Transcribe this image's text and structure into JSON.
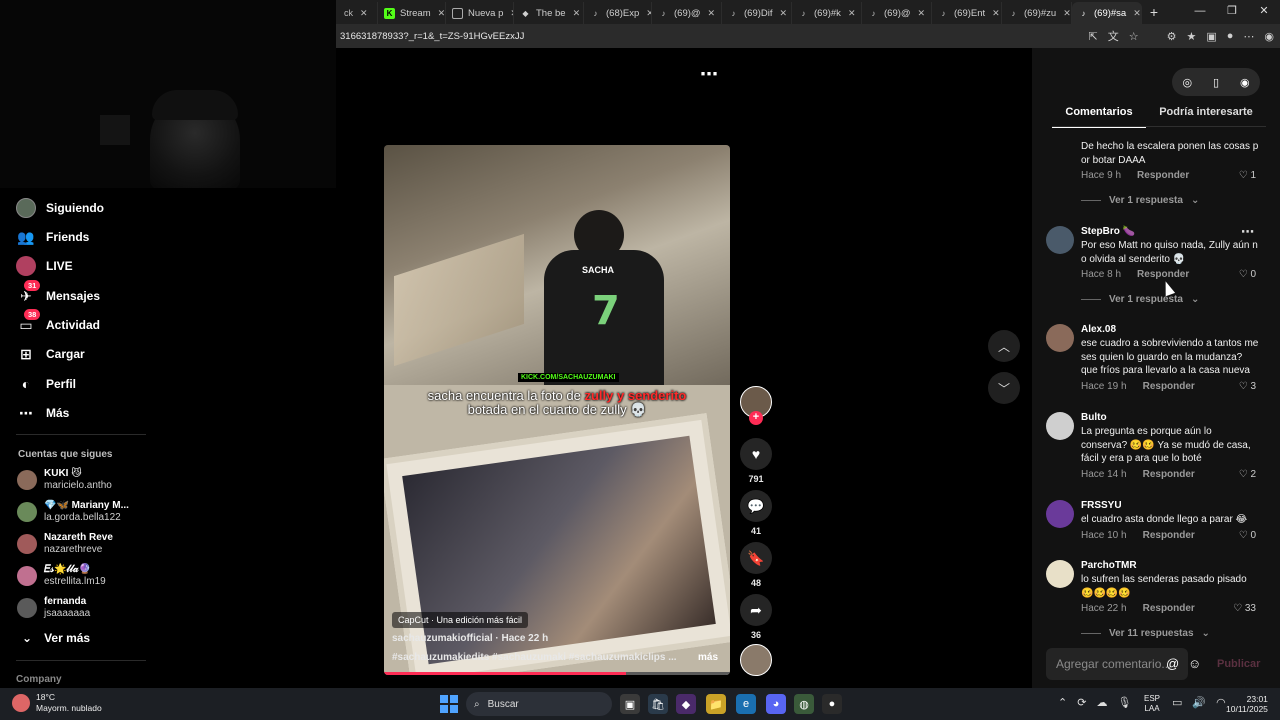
{
  "browser": {
    "tabs": [
      {
        "label": "ck",
        "icon": "tab-icon",
        "color": "#444"
      },
      {
        "label": "Stream",
        "icon": "kick-icon",
        "color": "#53fc18"
      },
      {
        "label": "Nueva p",
        "icon": "newtab-icon",
        "color": "#888"
      },
      {
        "label": "The be",
        "icon": "shield-icon",
        "color": "#ddd"
      },
      {
        "label": "(68)Exp",
        "icon": "tiktok-icon",
        "color": "#fff"
      },
      {
        "label": "(69)@",
        "icon": "tiktok-icon",
        "color": "#fff"
      },
      {
        "label": "(69)Dif",
        "icon": "tiktok-icon",
        "color": "#fff"
      },
      {
        "label": "(69)#k",
        "icon": "tiktok-icon",
        "color": "#fff"
      },
      {
        "label": "(69)@",
        "icon": "tiktok-icon",
        "color": "#fff"
      },
      {
        "label": "(69)Ent",
        "icon": "tiktok-icon",
        "color": "#fff"
      },
      {
        "label": "(69)#zu",
        "icon": "tiktok-icon",
        "color": "#fff"
      },
      {
        "label": "(69)#sa",
        "icon": "tiktok-icon",
        "color": "#fff"
      }
    ],
    "url": "316631878933?_r=1&_t=ZS-91HGvEEzxJJ"
  },
  "nav": {
    "items": [
      {
        "label": "Siguiendo",
        "icon": "following-avatar-icon"
      },
      {
        "label": "Friends",
        "icon": "friends-icon"
      },
      {
        "label": "LIVE",
        "icon": "live-icon"
      },
      {
        "label": "Mensajes",
        "icon": "messages-icon",
        "badge": "31"
      },
      {
        "label": "Actividad",
        "icon": "activity-icon",
        "badge": "38"
      },
      {
        "label": "Cargar",
        "icon": "upload-icon"
      },
      {
        "label": "Perfil",
        "icon": "profile-icon"
      },
      {
        "label": "Más",
        "icon": "more-icon"
      }
    ],
    "following_header": "Cuentas que sigues",
    "following": [
      {
        "name": "KUKI 😼",
        "user": "maricielo.antho",
        "color": "#8a6a5a"
      },
      {
        "name": "💎🦋 Mariany M...",
        "user": "la.gorda.bella122",
        "color": "#6a8a5a"
      },
      {
        "name": "Nazareth Reve",
        "user": "nazarethreve",
        "color": "#a05a5a"
      },
      {
        "name": "𝐸𝓈🌟𝓁𝓁𝒶🔮",
        "user": "estrellita.lm19",
        "color": "#c07090"
      },
      {
        "name": "fernanda",
        "user": "jsaaaaaaa",
        "color": "#5a5a5a"
      }
    ],
    "see_more": "Ver más",
    "company": "Company"
  },
  "video": {
    "caption_pre": "sacha encuentra la foto de ",
    "caption_red": "zully y senderito",
    "caption_post": "botada en el cuarto de zully 💀",
    "jersey_name": "SACHA",
    "jersey_number": "7",
    "kick_tag": "KICK.COM/SACHAUZUMAKI",
    "capcut": "CapCut · Una edición más fácil",
    "author_time": "sachauzumakiofficial · Hace 22 h",
    "tags": "#sachauzumakiedits #sachauzumaki #sachauzumakiclips ...",
    "more": "más",
    "progress": 0.7
  },
  "actions": {
    "likes": "791",
    "comments": "41",
    "saves": "48",
    "shares": "36"
  },
  "panel": {
    "tab_comments": "Comentarios",
    "tab_interest": "Podría interesarte",
    "reply_label": "Responder",
    "comments": [
      {
        "user": "",
        "text": "De hecho la escalera ponen las cosas p or botar DAAA",
        "time": "Hace 9 h",
        "likes": "1",
        "replies": "Ver 1 respuesta",
        "color": "#121212"
      },
      {
        "user": "StepBro 🍆",
        "text": "Por eso Matt no quiso nada, Zully aún n o olvida al senderito 💀",
        "time": "Hace 8 h",
        "likes": "0",
        "replies": "Ver 1 respuesta",
        "color": "#4a5a6a"
      },
      {
        "user": "Alex.08",
        "text": "ese cuadro a sobreviviendo a tantos me ses quien lo guardo en la mudanza? que fríos para llevarlo a la casa nueva",
        "time": "Hace 19 h",
        "likes": "3",
        "replies": "",
        "color": "#8a6a5a"
      },
      {
        "user": "Bulto",
        "text": "La pregunta es porque aún lo conserva? 🥴🥴 Ya se mudó de casa, fácil y era p ara que lo boté",
        "time": "Hace 14 h",
        "likes": "2",
        "replies": "",
        "color": "#cfcfcf"
      },
      {
        "user": "FRSSYU",
        "text": "el cuadro asta donde llego a parar 😂",
        "time": "Hace 10 h",
        "likes": "0",
        "replies": "",
        "color": "#6a3a9a"
      },
      {
        "user": "ParchoTMR",
        "text": "lo sufren las senderas pasado pisado 🥴🥴🥴🥴",
        "time": "Hace 22 h",
        "likes": "33",
        "replies": "Ver 11 respuestas",
        "color": "#e8e0c8"
      }
    ],
    "input_placeholder": "Agregar comentario...",
    "publish": "Publicar"
  },
  "taskbar": {
    "temp": "18°C",
    "weather": "Mayorm. nublado",
    "search": "Buscar",
    "lang1": "ESP",
    "lang2": "LAA",
    "time": "23:01",
    "date": "10/11/2025"
  }
}
